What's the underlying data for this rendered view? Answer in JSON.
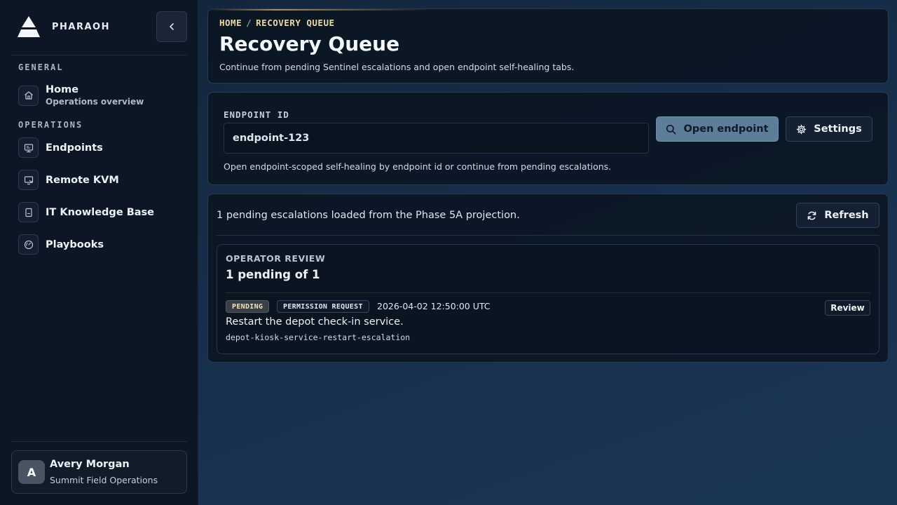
{
  "brand": {
    "name": "PHARAOH"
  },
  "sidebar": {
    "sections": [
      {
        "label": "GENERAL"
      },
      {
        "label": "OPERATIONS"
      }
    ],
    "items": [
      {
        "label": "Home",
        "sub": "Operations overview",
        "icon": "home-icon"
      },
      {
        "label": "Endpoints",
        "icon": "endpoints-icon"
      },
      {
        "label": "Remote KVM",
        "icon": "remote-kvm-icon"
      },
      {
        "label": "IT Knowledge Base",
        "icon": "knowledge-base-icon"
      },
      {
        "label": "Playbooks",
        "icon": "playbooks-icon"
      }
    ],
    "user": {
      "initial": "A",
      "name": "Avery Morgan",
      "org": "Summit Field Operations"
    }
  },
  "header": {
    "breadcrumb": [
      "HOME",
      "RECOVERY QUEUE"
    ],
    "breadcrumb_sep": "/",
    "title": "Recovery Queue",
    "description": "Continue from pending Sentinel escalations and open endpoint self-healing tabs."
  },
  "endpoint": {
    "label": "ENDPOINT ID",
    "value": "endpoint-123",
    "placeholder": "",
    "open_label": "Open endpoint",
    "settings_label": "Settings",
    "hint": "Open endpoint-scoped self-healing by endpoint id or continue from pending escalations."
  },
  "queue": {
    "status": "1 pending escalations loaded from the Phase 5A projection.",
    "refresh_label": "Refresh",
    "review": {
      "eyebrow": "OPERATOR REVIEW",
      "count": "1 pending of 1",
      "escalations": [
        {
          "status": "PENDING",
          "type": "PERMISSION REQUEST",
          "timestamp": "2026-04-02 12:50:00 UTC",
          "description": "Restart the depot check-in service.",
          "id": "depot-kiosk-service-restart-escalation",
          "action": "Review"
        }
      ]
    }
  },
  "colors": {
    "accent": "#5d7d99",
    "breadcrumb": "#e9d9a8",
    "sidebar_bg": "#0c1624"
  }
}
